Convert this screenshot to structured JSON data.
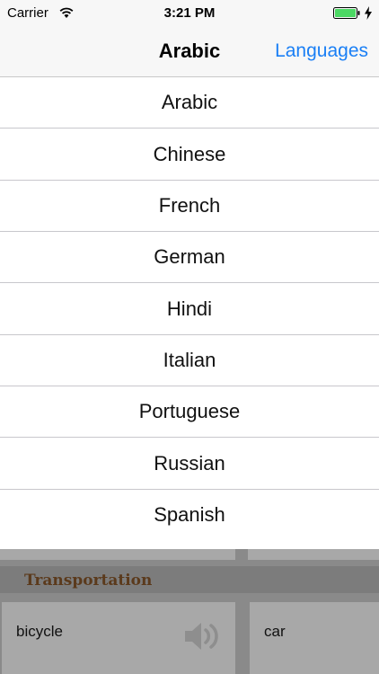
{
  "status_bar": {
    "carrier": "Carrier",
    "time": "3:21 PM"
  },
  "nav": {
    "title": "Arabic",
    "right_button": "Languages"
  },
  "languages": [
    "Arabic",
    "Chinese",
    "French",
    "German",
    "Hindi",
    "Italian",
    "Portuguese",
    "Russian",
    "Spanish"
  ],
  "section": {
    "title": "Transportation"
  },
  "cards": [
    {
      "label": "bicycle",
      "icon": "speaker-icon"
    },
    {
      "label": "car"
    }
  ],
  "colors": {
    "accent": "#1a7ff5",
    "battery": "#4cd964",
    "section_title": "#5b3a1c"
  }
}
